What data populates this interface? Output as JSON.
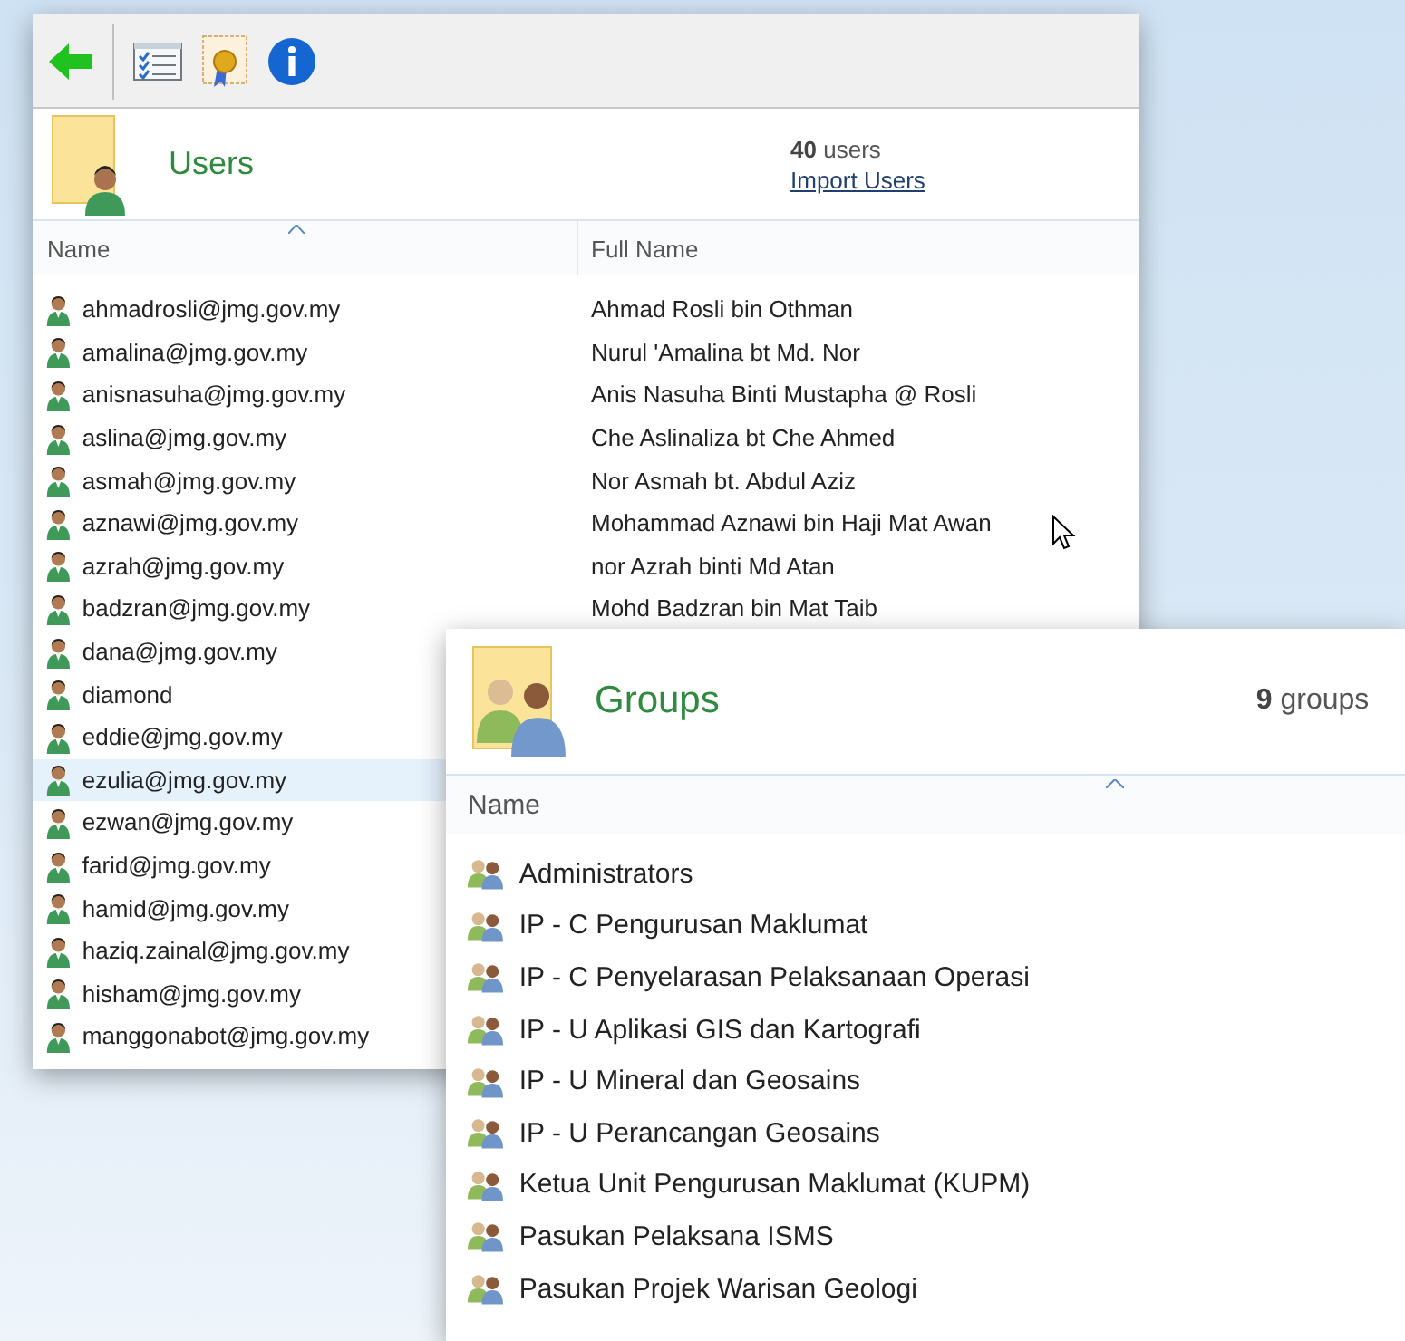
{
  "users_window": {
    "toolbar": [
      {
        "kind": "back"
      },
      {
        "kind": "checklist"
      },
      {
        "kind": "certificate"
      },
      {
        "kind": "info"
      }
    ],
    "title": "Users",
    "count": "40",
    "count_label": "users",
    "import_link": "Import Users",
    "columns": [
      "Name",
      "Full Name"
    ],
    "rows": [
      {
        "name": "ahmadrosli@jmg.gov.my",
        "full_name": "Ahmad Rosli bin Othman",
        "selected": false
      },
      {
        "name": "amalina@jmg.gov.my",
        "full_name": "Nurul 'Amalina bt Md. Nor",
        "selected": false
      },
      {
        "name": "anisnasuha@jmg.gov.my",
        "full_name": "Anis Nasuha Binti Mustapha @ Rosli",
        "selected": false
      },
      {
        "name": "aslina@jmg.gov.my",
        "full_name": "Che Aslinaliza bt Che Ahmed",
        "selected": false
      },
      {
        "name": "asmah@jmg.gov.my",
        "full_name": "Nor Asmah bt. Abdul Aziz",
        "selected": false
      },
      {
        "name": "aznawi@jmg.gov.my",
        "full_name": "Mohammad Aznawi bin Haji Mat Awan",
        "selected": false
      },
      {
        "name": "azrah@jmg.gov.my",
        "full_name": "nor Azrah binti Md Atan",
        "selected": false
      },
      {
        "name": "badzran@jmg.gov.my",
        "full_name": "Mohd Badzran bin Mat Taib",
        "selected": false
      },
      {
        "name": "dana@jmg.gov.my",
        "selected": false
      },
      {
        "name": "diamond",
        "selected": false
      },
      {
        "name": "eddie@jmg.gov.my",
        "selected": false
      },
      {
        "name": "ezulia@jmg.gov.my",
        "selected": true
      },
      {
        "name": "ezwan@jmg.gov.my",
        "selected": false
      },
      {
        "name": "farid@jmg.gov.my",
        "selected": false
      },
      {
        "name": "hamid@jmg.gov.my",
        "selected": false
      },
      {
        "name": "haziq.zainal@jmg.gov.my",
        "selected": false
      },
      {
        "name": "hisham@jmg.gov.my",
        "selected": false
      },
      {
        "name": "manggonabot@jmg.gov.my",
        "selected": false
      }
    ]
  },
  "groups_window": {
    "title": "Groups",
    "count": "9",
    "count_label": "groups",
    "columns": [
      "Name"
    ],
    "rows": [
      {
        "name": "Administrators"
      },
      {
        "name": "IP - C Pengurusan Maklumat"
      },
      {
        "name": "IP - C Penyelarasan Pelaksanaan Operasi"
      },
      {
        "name": "IP - U Aplikasi GIS dan Kartografi"
      },
      {
        "name": "IP - U Mineral dan Geosains"
      },
      {
        "name": "IP - U Perancangan Geosains"
      },
      {
        "name": "Ketua Unit Pengurusan Maklumat (KUPM)"
      },
      {
        "name": "Pasukan Pelaksana ISMS"
      },
      {
        "name": "Pasukan Projek Warisan Geologi"
      }
    ]
  }
}
